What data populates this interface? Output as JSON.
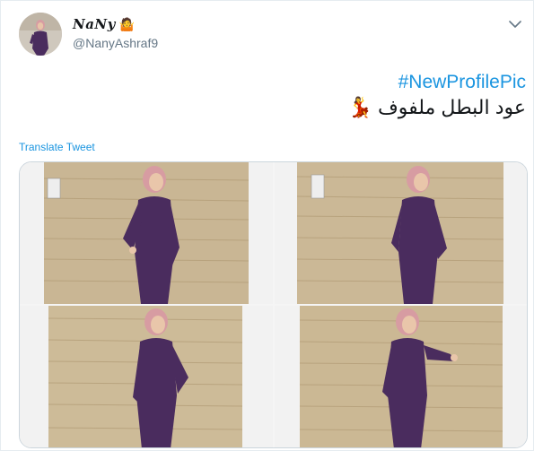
{
  "user": {
    "display_name": "NaNy",
    "name_emoji": "🤷",
    "handle": "@NanyAshraf9"
  },
  "tweet": {
    "hashtag": "#NewProfilePic",
    "text": "عود البطل ملفوف",
    "text_emoji": "💃",
    "translate_label": "Translate Tweet"
  },
  "icons": {
    "menu": "chevron-down-icon"
  },
  "media": {
    "photo_count": 4
  },
  "colors": {
    "link": "#1b95e0",
    "secondary_text": "#657786",
    "border": "#e6ecf0",
    "outfit": "#4a2c5e",
    "hijab": "#d79ca2",
    "wall": "#c9b694"
  }
}
